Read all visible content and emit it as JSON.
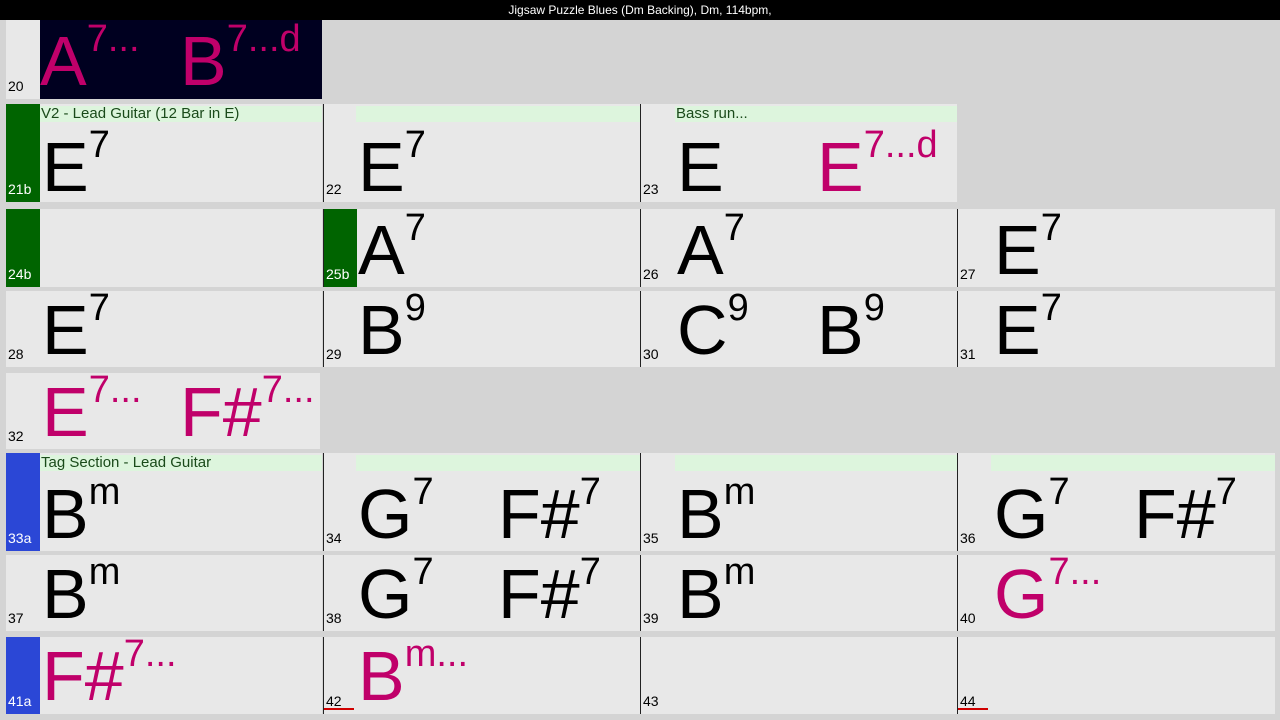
{
  "window": {
    "title": "Jigsaw Puzzle Blues (Dm Backing), Dm, 114bpm,"
  },
  "colors": {
    "chord": "#000000",
    "push_chord": "#c0006a",
    "section_green": "#006400",
    "section_blue": "#2b47d6",
    "label_bg": "#ddf5dd"
  },
  "section_labels": {
    "v2": "V2 - Lead Guitar (12 Bar in E)",
    "bass_run": "Bass run...",
    "tag": "Tag Section - Lead Guitar"
  },
  "bars": {
    "b20": {
      "number": "20",
      "c1r": "A",
      "c1q": "7...",
      "c2r": "B",
      "c2q": "7...d"
    },
    "b21": {
      "number": "21b",
      "c1r": "E",
      "c1q": "7"
    },
    "b22": {
      "number": "22",
      "c1r": "E",
      "c1q": "7"
    },
    "b23": {
      "number": "23",
      "c1r": "E",
      "c1q": "",
      "c2r": "E",
      "c2q": "7...d"
    },
    "b24": {
      "number": "24b"
    },
    "b25": {
      "number": "25b",
      "c1r": "A",
      "c1q": "7"
    },
    "b26": {
      "number": "26",
      "c1r": "A",
      "c1q": "7"
    },
    "b27": {
      "number": "27",
      "c1r": "E",
      "c1q": "7"
    },
    "b28": {
      "number": "28",
      "c1r": "E",
      "c1q": "7"
    },
    "b29": {
      "number": "29",
      "c1r": "B",
      "c1q": "9"
    },
    "b30": {
      "number": "30",
      "c1r": "C",
      "c1q": "9",
      "c2r": "B",
      "c2q": "9"
    },
    "b31": {
      "number": "31",
      "c1r": "E",
      "c1q": "7"
    },
    "b32": {
      "number": "32",
      "c1r": "E",
      "c1q": "7...",
      "c2r": "F#",
      "c2q": "7..."
    },
    "b33": {
      "number": "33a",
      "c1r": "B",
      "c1q": "m"
    },
    "b34": {
      "number": "34",
      "c1r": "G",
      "c1q": "7",
      "c2r": "F#",
      "c2q": "7"
    },
    "b35": {
      "number": "35",
      "c1r": "B",
      "c1q": "m"
    },
    "b36": {
      "number": "36",
      "c1r": "G",
      "c1q": "7",
      "c2r": "F#",
      "c2q": "7"
    },
    "b37": {
      "number": "37",
      "c1r": "B",
      "c1q": "m"
    },
    "b38": {
      "number": "38",
      "c1r": "G",
      "c1q": "7",
      "c2r": "F#",
      "c2q": "7"
    },
    "b39": {
      "number": "39",
      "c1r": "B",
      "c1q": "m"
    },
    "b40": {
      "number": "40",
      "c1r": "G",
      "c1q": "7..."
    },
    "b41": {
      "number": "41a",
      "c1r": "F#",
      "c1q": "7..."
    },
    "b42": {
      "number": "42",
      "c1r": "B",
      "c1q": "m..."
    },
    "b43": {
      "number": "43"
    },
    "b44": {
      "number": "44"
    }
  }
}
